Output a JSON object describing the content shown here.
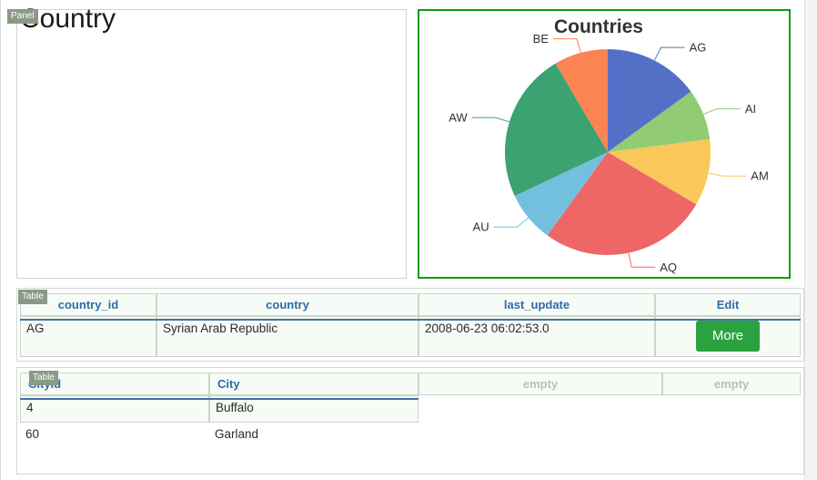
{
  "panel": {
    "badge": "Panel",
    "title": "Country"
  },
  "chart_panel": {
    "badge": "",
    "border_color": "#0f9e0f"
  },
  "chart_data": {
    "type": "pie",
    "title": "Countries",
    "labels": [
      "AG",
      "AI",
      "AM",
      "AQ",
      "AU",
      "AW",
      "BE"
    ],
    "values": [
      15.0,
      8.0,
      10.5,
      26.5,
      8.0,
      23.5,
      8.5
    ],
    "colors": [
      "#5470c6",
      "#91cc75",
      "#fac858",
      "#ee6666",
      "#73c0de",
      "#3ba272",
      "#fc8452"
    ],
    "start_angle_deg": -90,
    "direction": "clockwise",
    "legend": "none",
    "labels_position": "outside-with-leader-lines",
    "grid": false
  },
  "country_table": {
    "badge": "Table",
    "columns": [
      "country_id",
      "country",
      "last_update",
      "Edit"
    ],
    "rows": [
      {
        "country_id": "AG",
        "country": "Syrian Arab Republic",
        "last_update": "2008-06-23 06:02:53.0",
        "edit_label": "More"
      }
    ]
  },
  "city_table": {
    "badge": "Table",
    "columns": [
      "CityId",
      "City",
      "",
      ""
    ],
    "empty_label": "empty",
    "rows": [
      {
        "city_id": "4",
        "city": "Buffalo"
      },
      {
        "city_id": "60",
        "city": "Garland"
      }
    ]
  },
  "colors": {
    "header_text": "#2f6bab",
    "header_rule": "#4472a8",
    "cell_bg": "#f6fbf6",
    "cell_border": "#c9d6c9",
    "badge_bg": "#8a9a84",
    "more_button": "#2aa33f",
    "chart_border": "#0f9e0f"
  }
}
